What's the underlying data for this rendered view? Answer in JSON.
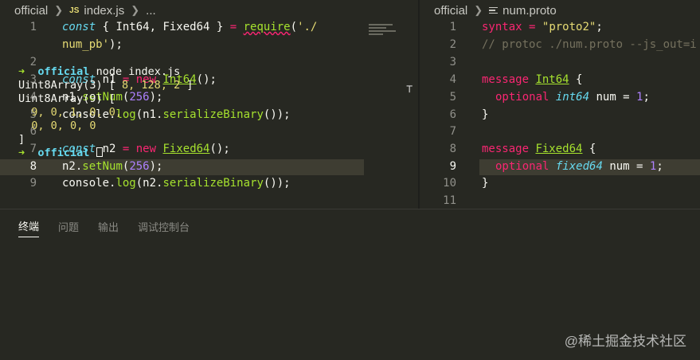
{
  "left_editor": {
    "breadcrumb": {
      "folder": "official",
      "js_badge": "JS",
      "file": "index.js",
      "ellipsis": "..."
    },
    "line_numbers": [
      "1",
      "",
      "2",
      "3",
      "4",
      "5",
      "6",
      "7",
      "8",
      "9"
    ],
    "lines": {
      "l1a": {
        "kw": "const",
        "p1": " { Int64, Fixed64 } ",
        "eq": "=",
        "sp": " ",
        "fn": "require",
        "p2": "(",
        "str": "'./"
      },
      "l1b": {
        "str": "num_pb'",
        "p": ");"
      },
      "l3": {
        "kw": "const",
        "p1": " n1 ",
        "eq": "=",
        "sp": " ",
        "new": "new",
        "sp2": " ",
        "cls": "Int64",
        "p2": "();"
      },
      "l4": {
        "p1": "n1.",
        "fn": "setNum",
        "p2": "(",
        "num": "256",
        "p3": ");"
      },
      "l5": {
        "p1": "console.",
        "fn": "log",
        "p2": "(n1.",
        "fn2": "serializeBinary",
        "p3": "());"
      },
      "l7": {
        "kw": "const",
        "p1": " n2 ",
        "eq": "=",
        "sp": " ",
        "new": "new",
        "sp2": " ",
        "cls": "Fixed64",
        "p2": "();"
      },
      "l8": {
        "p1": "n2.",
        "fn": "setNum",
        "p2": "(",
        "num": "256",
        "p3": ");"
      },
      "l9": {
        "p1": "console.",
        "fn": "log",
        "p2": "(n2.",
        "fn2": "serializeBinary",
        "p3": "());"
      }
    }
  },
  "right_editor": {
    "breadcrumb": {
      "folder": "official",
      "file": "num.proto"
    },
    "line_numbers": [
      "1",
      "2",
      "3",
      "4",
      "5",
      "6",
      "7",
      "8",
      "9",
      "10",
      "11"
    ],
    "lines": {
      "l1": {
        "a": "syntax ",
        "eq": "=",
        "sp": " ",
        "str": "\"proto2\"",
        "p": ";"
      },
      "l2": {
        "cmt": "// protoc ./num.proto --js_out=i"
      },
      "l4": {
        "kw": "message",
        "sp": " ",
        "name": "Int64",
        "p": " {"
      },
      "l5": {
        "opt": "optional",
        "sp": " ",
        "type": "int64",
        "rest": " num = ",
        "num": "1",
        "p": ";"
      },
      "l6": {
        "p": "}"
      },
      "l8": {
        "kw": "message",
        "sp": " ",
        "name": "Fixed64",
        "p": " {"
      },
      "l9": {
        "opt": "optional",
        "sp": " ",
        "type": "fixed64",
        "rest": " num = ",
        "num": "1",
        "p": ";"
      },
      "l10": {
        "p": "}"
      }
    }
  },
  "panel": {
    "tabs": [
      "终端",
      "问题",
      "输出",
      "调试控制台"
    ],
    "terminal": {
      "prompt_arrow": "➜",
      "prompt_dir": "official",
      "command": " node index.js",
      "out1_prefix": "Uint8Array(3) [ ",
      "out1_nums": "8, 128, 2",
      "out1_suffix": " ]",
      "out2": "Uint8Array(9) [",
      "out3": "  9, 0, 1, 0, 0,",
      "out4": "  0, 0, 0, 0",
      "out5": "]",
      "prompt2_dir": "official"
    }
  },
  "watermark": "@稀土掘金技术社区",
  "colors": {
    "background": "#272822",
    "keyword": "#f92672",
    "function": "#a6e22e",
    "string": "#e6db74",
    "number": "#ae81ff",
    "type": "#66d9ef"
  }
}
